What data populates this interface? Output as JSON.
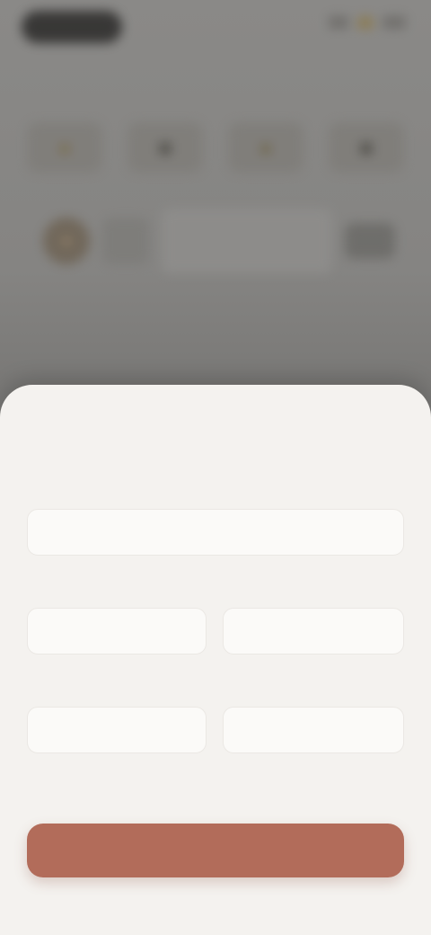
{
  "status_bar": {
    "time": "",
    "icons": [
      "signal-icon",
      "wifi-icon",
      "battery-icon"
    ]
  },
  "background_app": {
    "title": "",
    "tiles": [
      {
        "icon": "tile-icon-1",
        "glyph": "●"
      },
      {
        "icon": "tile-icon-2",
        "glyph": "■"
      },
      {
        "icon": "tile-icon-3",
        "glyph": "●"
      },
      {
        "icon": "tile-icon-4",
        "glyph": "■"
      }
    ]
  },
  "sheet": {
    "title": "",
    "fields": {
      "field_1": {
        "label": "",
        "value": "",
        "placeholder": ""
      },
      "field_2": {
        "label": "",
        "value": "",
        "placeholder": ""
      },
      "field_3": {
        "label": "",
        "value": "",
        "placeholder": ""
      },
      "field_4": {
        "label": "",
        "value": "",
        "placeholder": ""
      },
      "field_5": {
        "label": "",
        "value": "",
        "placeholder": ""
      }
    },
    "submit_label": ""
  },
  "colors": {
    "accent": "#b26c5a",
    "sheet_background": "#f4f2ef",
    "field_background": "#fbfaf8",
    "dimmed_background": "#7c7b79"
  }
}
